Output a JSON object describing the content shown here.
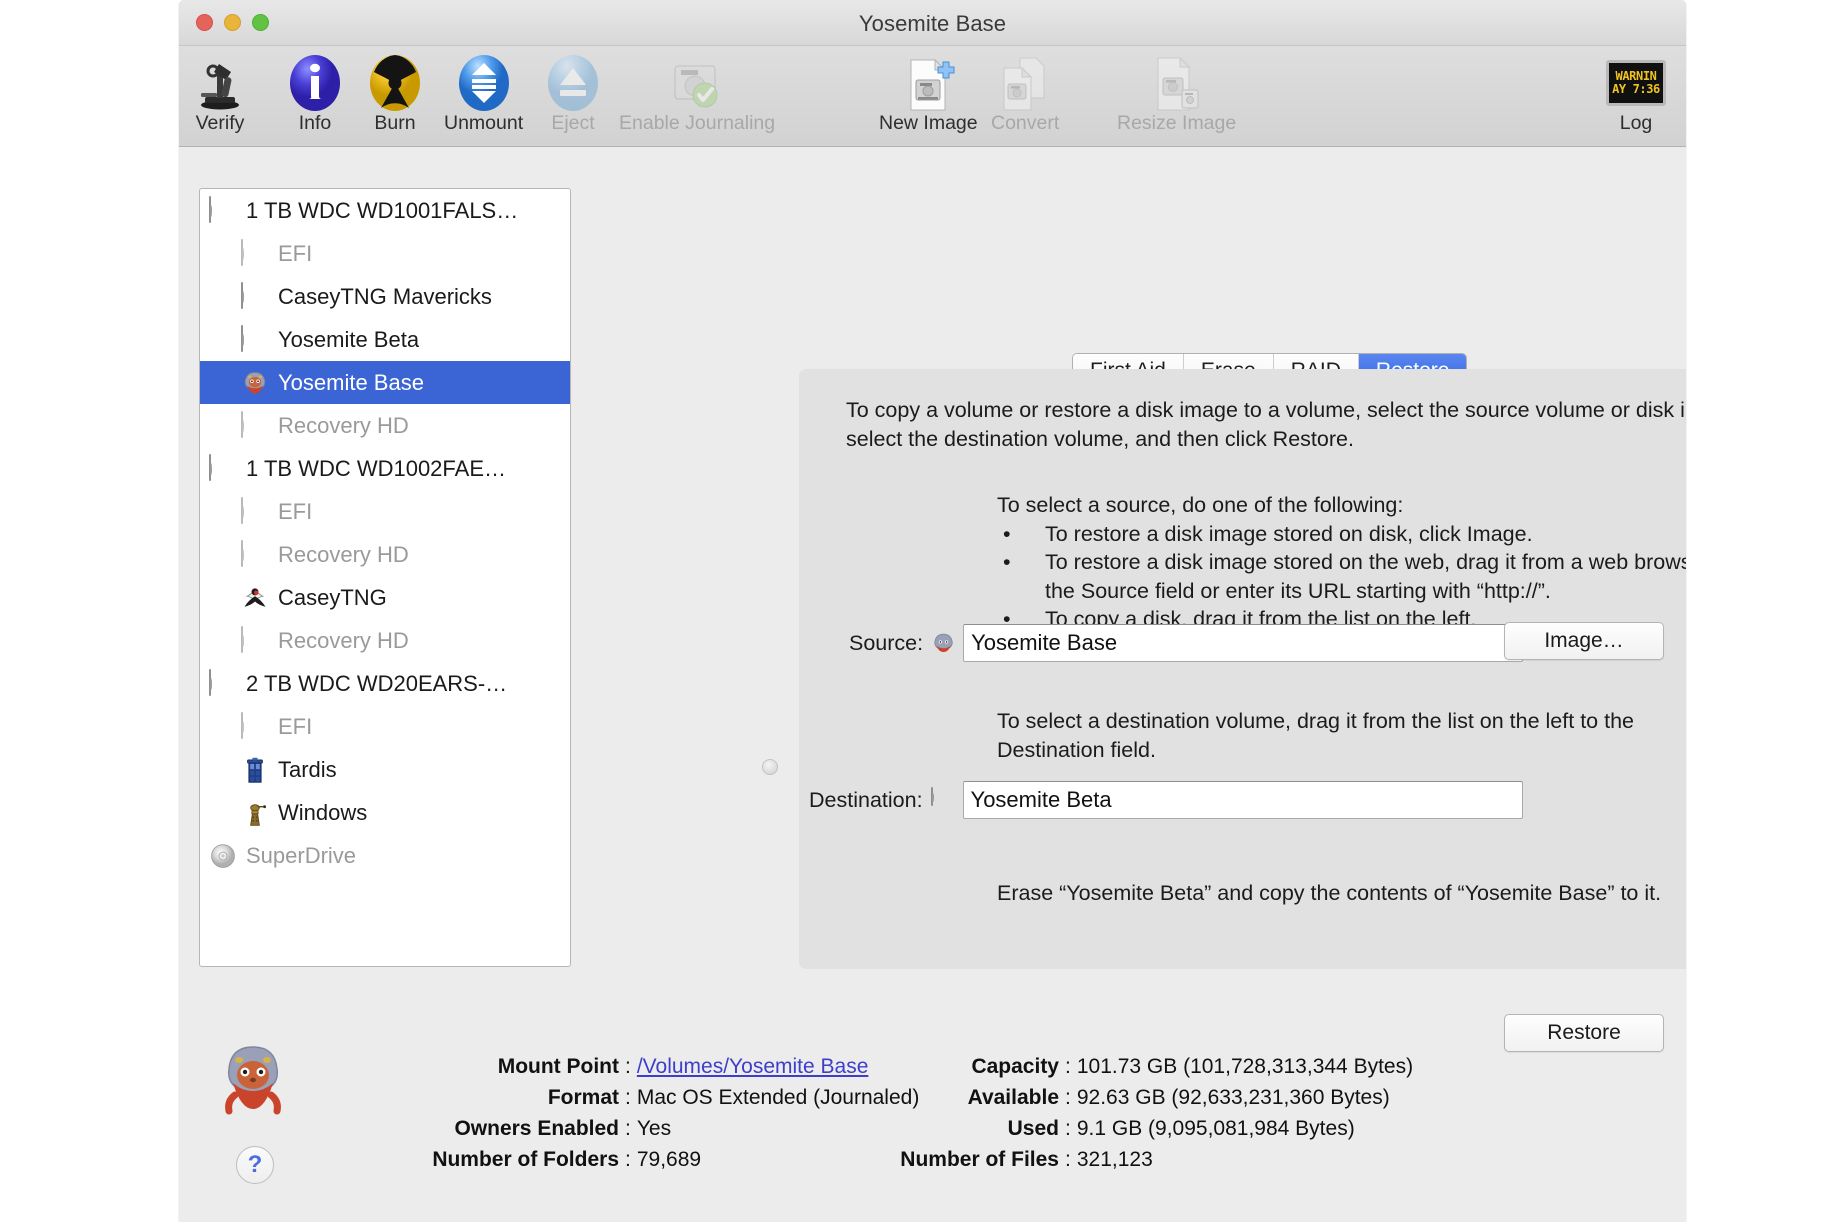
{
  "window": {
    "title": "Yosemite Base"
  },
  "toolbar": {
    "items": [
      {
        "label": "Verify",
        "icon": "microscope-icon",
        "enabled": true
      },
      {
        "label": "Info",
        "icon": "info-circle-icon",
        "enabled": true
      },
      {
        "label": "Burn",
        "icon": "burn-radiation-icon",
        "enabled": true
      },
      {
        "label": "Unmount",
        "icon": "unmount-arrows-icon",
        "enabled": true
      },
      {
        "label": "Eject",
        "icon": "eject-icon",
        "enabled": false
      },
      {
        "label": "Enable Journaling",
        "icon": "disk-checkmark-icon",
        "enabled": false
      },
      {
        "label": "New Image",
        "icon": "new-image-plus-icon",
        "enabled": true
      },
      {
        "label": "Convert",
        "icon": "convert-documents-icon",
        "enabled": false
      },
      {
        "label": "Resize Image",
        "icon": "resize-image-icon",
        "enabled": false
      }
    ],
    "log": {
      "label": "Log",
      "icon": "log-display-icon",
      "screen_line1": "WARNIN",
      "screen_line2": "AY 7:36"
    }
  },
  "sidebar": {
    "volumes": [
      {
        "label": "1 TB WDC WD1001FALS…",
        "icon": "hard-disk-icon",
        "indent": false,
        "dim": false,
        "selected": false
      },
      {
        "label": "EFI",
        "icon": "hard-disk-icon",
        "indent": true,
        "dim": true,
        "selected": false
      },
      {
        "label": "CaseyTNG Mavericks",
        "icon": "hard-disk-icon",
        "indent": true,
        "dim": false,
        "selected": false
      },
      {
        "label": "Yosemite Beta",
        "icon": "hard-disk-icon",
        "indent": true,
        "dim": false,
        "selected": false
      },
      {
        "label": "Yosemite Base",
        "icon": "gopher-mascot-icon",
        "indent": true,
        "dim": false,
        "selected": true
      },
      {
        "label": "Recovery HD",
        "icon": "hard-disk-icon",
        "indent": true,
        "dim": true,
        "selected": false
      },
      {
        "label": "1 TB WDC WD1002FAE…",
        "icon": "hard-disk-icon",
        "indent": false,
        "dim": false,
        "selected": false
      },
      {
        "label": "EFI",
        "icon": "hard-disk-icon",
        "indent": true,
        "dim": true,
        "selected": false
      },
      {
        "label": "Recovery HD",
        "icon": "hard-disk-icon",
        "indent": true,
        "dim": true,
        "selected": false
      },
      {
        "label": "CaseyTNG",
        "icon": "bird-mascot-icon",
        "indent": true,
        "dim": false,
        "selected": false
      },
      {
        "label": "Recovery HD",
        "icon": "hard-disk-icon",
        "indent": true,
        "dim": true,
        "selected": false
      },
      {
        "label": "2 TB WDC WD20EARS-…",
        "icon": "hard-disk-icon",
        "indent": false,
        "dim": false,
        "selected": false
      },
      {
        "label": "EFI",
        "icon": "hard-disk-icon",
        "indent": true,
        "dim": true,
        "selected": false
      },
      {
        "label": "Tardis",
        "icon": "tardis-icon",
        "indent": true,
        "dim": false,
        "selected": false
      },
      {
        "label": "Windows",
        "icon": "dalek-icon",
        "indent": true,
        "dim": false,
        "selected": false
      },
      {
        "label": "SuperDrive",
        "icon": "optical-disc-icon",
        "indent": false,
        "dim": true,
        "selected": false
      }
    ]
  },
  "tabs": [
    {
      "label": "First Aid",
      "active": false
    },
    {
      "label": "Erase",
      "active": false
    },
    {
      "label": "RAID",
      "active": false
    },
    {
      "label": "Restore",
      "active": true
    }
  ],
  "panel": {
    "intro": "To copy a volume or restore a disk image to a volume, select the source volume or disk image, select the destination volume, and then click Restore.",
    "source_steps_title": "To select a source, do one of the following:",
    "source_steps": [
      "To restore a disk image stored on disk, click Image.",
      "To restore a disk image stored on the web, drag it from a web browser to the Source field or enter its URL starting with “http://”.",
      "To copy a disk, drag it from the list on the left."
    ],
    "bullet_char": "•",
    "source": {
      "label": "Source:",
      "value": "Yosemite Base",
      "icon": "gopher-mascot-icon"
    },
    "image_button": "Image…",
    "destination_help": "To select a destination volume, drag it from the list on the left to the Destination field.",
    "destination": {
      "label": "Destination:",
      "value": "Yosemite Beta",
      "icon": "hard-disk-icon"
    },
    "erase_note": "Erase “Yosemite Beta” and copy the contents of “Yosemite Base” to it.",
    "restore_button": "Restore"
  },
  "info": {
    "mascot_icon": "gopher-mascot-icon",
    "help_button": "?",
    "separator": ":",
    "left": [
      {
        "key": "Mount Point",
        "value": "/Volumes/Yosemite Base",
        "link": true
      },
      {
        "key": "Format",
        "value": "Mac OS Extended (Journaled)",
        "link": false
      },
      {
        "key": "Owners Enabled",
        "value": "Yes",
        "link": false
      },
      {
        "key": "Number of Folders",
        "value": "79,689",
        "link": false
      }
    ],
    "right": [
      {
        "key": "Capacity",
        "value": "101.73 GB (101,728,313,344 Bytes)"
      },
      {
        "key": "Available",
        "value": "92.63 GB (92,633,231,360 Bytes)"
      },
      {
        "key": "Used",
        "value": "9.1 GB (9,095,081,984 Bytes)"
      },
      {
        "key": "Number of Files",
        "value": "321,123"
      }
    ]
  },
  "colors": {
    "selection_blue": "#3b65d4",
    "tab_active_blue": "#2f64e0",
    "link_blue": "#3e3ecb",
    "window_bg": "#ececec",
    "panel_bg": "#e1e1e1"
  }
}
